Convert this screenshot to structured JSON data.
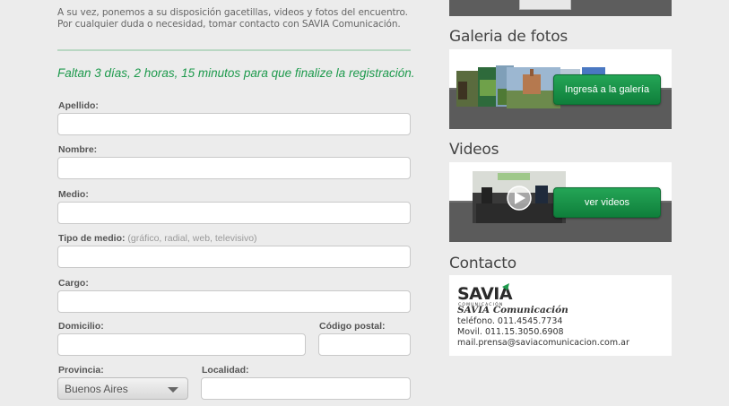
{
  "intro": {
    "line1": "A su vez, ponemos a su disposición gacetillas, videos y fotos del encuentro.",
    "line2": "Por cualquier duda o necesidad, tomar contacto con SAVIA Comunicación."
  },
  "countdown": "Faltan 3 días, 2 horas, 15 minutos para que finalize la registración.",
  "form": {
    "apellido_label": "Apellido:",
    "apellido_value": "",
    "nombre_label": "Nombre:",
    "nombre_value": "",
    "medio_label": "Medio:",
    "medio_value": "",
    "tipo_medio_label": "Tipo de medio:",
    "tipo_medio_hint": "(gráfico, radial, web, televisivo)",
    "tipo_medio_value": "",
    "cargo_label": "Cargo:",
    "cargo_value": "",
    "domicilio_label": "Domicilio:",
    "domicilio_value": "",
    "codigo_postal_label": "Código postal:",
    "codigo_postal_value": "",
    "provincia_label": "Provincia:",
    "provincia_selected": "Buenos Aires",
    "localidad_label": "Localidad:",
    "localidad_value": ""
  },
  "sidebar": {
    "galeria_title": "Galeria de fotos",
    "galeria_button": "Ingresá a la galería",
    "videos_title": "Videos",
    "videos_button": "ver videos",
    "contacto_title": "Contacto",
    "contact": {
      "logo_text": "SAVIA",
      "logo_sub": "COMUNICACIÓN",
      "company": "SAVIA Comunicación",
      "phone": "teléfono. 011.4545.7734",
      "mobile": "Movil. 011.15.3050.6908",
      "email": "mail.prensa@saviacomunicacion.com.ar"
    }
  },
  "colors": {
    "accent_green": "#1e9a4d",
    "button_green": "#139446",
    "panel_dark": "#5b5b5b"
  }
}
